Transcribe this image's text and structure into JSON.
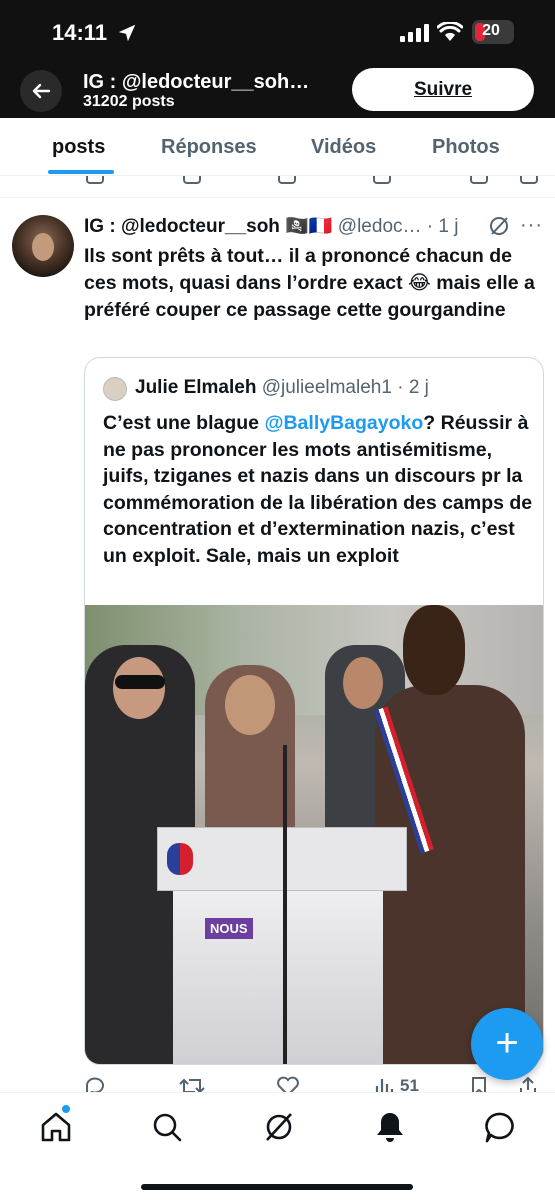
{
  "status_bar": {
    "time": "14:11",
    "battery": "20"
  },
  "header": {
    "title": "IG : @ledocteur__soh…",
    "posts_count": "31202 posts",
    "follow_label": "Suivre"
  },
  "tabs": [
    {
      "label": "posts",
      "active": true
    },
    {
      "label": "Réponses",
      "active": false
    },
    {
      "label": "Vidéos",
      "active": false
    },
    {
      "label": "Photos",
      "active": false
    }
  ],
  "tweet": {
    "name": "IG : @ledocteur__soh",
    "flags": "🏴‍☠️🇫🇷",
    "handle": "@ledoc…",
    "time": "· 1 j",
    "text": "Ils sont prêts à tout… il a prononcé chacun de ces mots, quasi dans l’ordre exact 😂 mais elle a préféré couper ce passage cette gourgandine",
    "quote": {
      "name": "Julie Elmaleh",
      "handle": "@julieelmaleh1",
      "time": "· 2 j",
      "text_before": "C’est une blague ",
      "mention": "@BallyBagayoko",
      "text_after": "? Réussir à ne pas prononcer les mots antisémitisme, juifs, tziganes et nazis dans un discours pr la commémoration de la libération des camps de concentration et d’extermination nazis, c’est un exploit. Sale, mais un exploit",
      "media_badge": "NOUS"
    },
    "views": "51"
  },
  "fab_label": "+",
  "colors": {
    "accent": "#1d9bf0",
    "header_bg": "#111111",
    "text": "#0f1419",
    "muted": "#536471"
  }
}
